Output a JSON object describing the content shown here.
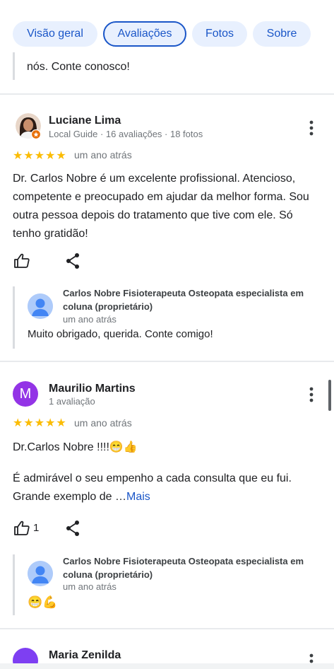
{
  "tabs": [
    {
      "label": "Visão geral"
    },
    {
      "label": "Avaliações"
    },
    {
      "label": "Fotos"
    },
    {
      "label": "Sobre"
    }
  ],
  "partial_reply": {
    "text": "nós. Conte conosco!"
  },
  "reviews": [
    {
      "name": "Luciane Lima",
      "meta": "Local Guide · 16 avaliações · 18 fotos",
      "stars": "★★★★★",
      "rating": 5,
      "when": "um ano atrás",
      "body": "Dr. Carlos Nobre é um excelente profissional. Atencioso, competente e preocupado em ajudar da melhor forma. Sou outra pessoa depois do tratamento que tive com ele. Só tenho gratidão!",
      "owner_name": "Carlos Nobre Fisioterapeuta Osteopata especialista em coluna (proprietário)",
      "owner_when": "um ano atrás",
      "owner_text": "Muito obrigado, querida. Conte comigo!"
    },
    {
      "name": "Maurilio Martins",
      "avatar_letter": "M",
      "avatar_color": "#9334e6",
      "meta": "1 avaliação",
      "stars": "★★★★★",
      "rating": 5,
      "when": "um ano atrás",
      "body_line1": "Dr.Carlos Nobre !!!!😁👍",
      "body_line2": "É admirável o seu empenho a cada consulta que eu fui. Grande exemplo de …",
      "more_label": "Mais",
      "like_count": "1",
      "owner_name": "Carlos Nobre Fisioterapeuta Osteopata especialista em coluna (proprietário)",
      "owner_when": "um ano atrás",
      "owner_text": "😁💪"
    },
    {
      "name": "Maria Zenilda"
    }
  ],
  "icons": {
    "like": "thumbs-up-icon",
    "share": "share-icon",
    "more": "more-vert-icon"
  },
  "colors": {
    "accent": "#1a56c8",
    "star": "#fbbc04",
    "tab_bg": "#e8f0fe"
  }
}
